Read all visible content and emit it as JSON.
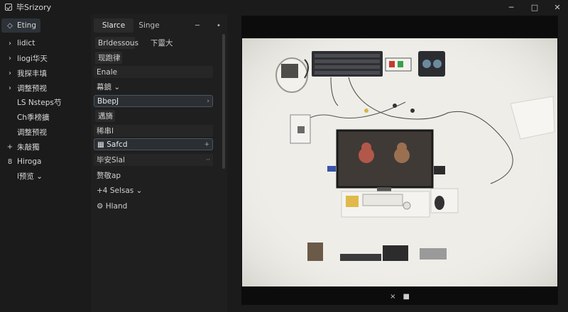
{
  "app": {
    "title": "毕Srizory"
  },
  "window_controls": {
    "minimize": "─",
    "maximize": "□",
    "close": "✕"
  },
  "sidebar": {
    "items": [
      {
        "icon": "◇",
        "label": "Eting",
        "selected": true
      },
      {
        "icon": "›",
        "label": "lidict"
      },
      {
        "icon": "›",
        "label": "liogi华天"
      },
      {
        "icon": "›",
        "label": "我探丰填"
      },
      {
        "icon": "›",
        "label": "调整预视"
      },
      {
        "icon": "",
        "label": "LS Nsteps芍"
      },
      {
        "icon": "",
        "label": "Ch季榜擴"
      },
      {
        "icon": "",
        "label": "调整预视"
      },
      {
        "icon": "+",
        "label": "朱敲獨"
      },
      {
        "icon": "8",
        "label": "Hiroga"
      },
      {
        "icon": "",
        "label": "l预览 ⌄"
      }
    ]
  },
  "panel": {
    "tabs": [
      {
        "label": "Slarce",
        "active": true
      },
      {
        "label": "Singe",
        "active": false
      }
    ],
    "controls": {
      "minimize": "─",
      "pin": "•"
    },
    "rows": [
      {
        "label": "Brldessous",
        "style": "box",
        "extra": "下靈大"
      },
      {
        "label": "现跑律",
        "style": "box"
      },
      {
        "label": "Enale",
        "style": "dark"
      },
      {
        "label": "幕鏡 ⌄",
        "style": "plain"
      },
      {
        "label": "BbepJ",
        "style": "highlight",
        "trail": "›"
      },
      {
        "label": "邁旖",
        "style": "box"
      },
      {
        "label": "稀串l",
        "style": "dark"
      },
      {
        "label": "▦ Safcd",
        "style": "highlight",
        "trail": "+"
      },
      {
        "label": "毕安Slal",
        "style": "dark",
        "trail": "··"
      },
      {
        "label": "赘敬ap",
        "style": "plain"
      },
      {
        "label": "+4  Selsas ⌄",
        "style": "plain"
      },
      {
        "label": "⚙  Hland",
        "style": "plain"
      }
    ]
  },
  "preview": {
    "footer": {
      "close": "×",
      "stop": "■"
    }
  }
}
